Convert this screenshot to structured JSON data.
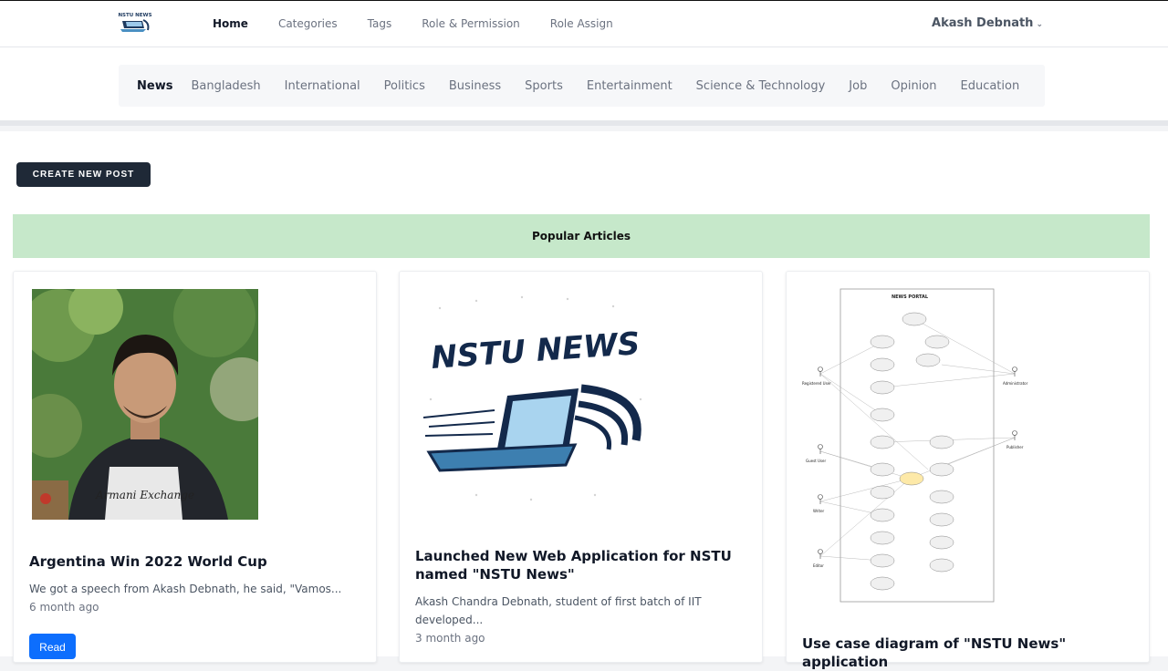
{
  "header": {
    "logo_text": "NSTU NEWS",
    "nav": [
      "Home",
      "Categories",
      "Tags",
      "Role & Permission",
      "Role Assign"
    ],
    "user_name": "Akash Debnath"
  },
  "categories": [
    "News",
    "Bangladesh",
    "International",
    "Politics",
    "Business",
    "Sports",
    "Entertainment",
    "Science & Technology",
    "Job",
    "Opinion",
    "Education"
  ],
  "actions": {
    "create_post_label": "CREATE NEW POST"
  },
  "section": {
    "popular_title": "Popular Articles"
  },
  "articles": [
    {
      "title": "Argentina Win 2022 World Cup",
      "excerpt": "We got a speech from Akash Debnath, he said, \"Vamos...",
      "time": "6 month ago",
      "read_label": "Read",
      "image": "portrait-photo",
      "image_text": "Armani Exchange"
    },
    {
      "title": "Launched New Web Application for NSTU named \"NSTU News\"",
      "excerpt": "Akash Chandra Debnath, student of first batch of IIT developed...",
      "time": "3 month ago",
      "image": "nstu-news-logo",
      "image_text": "NSTU NEWS"
    },
    {
      "title": "Use case diagram of \"NSTU News\" application",
      "image": "use-case-diagram",
      "image_text": "NEWS PORTAL",
      "diagram_actors": [
        "Registered User",
        "Guest User",
        "Writer",
        "Editor",
        "Administrator",
        "Publisher"
      ]
    }
  ],
  "colors": {
    "accent": "#0d6efd",
    "popular_bg": "#c6e8ca",
    "dark_button": "#1f2937"
  }
}
